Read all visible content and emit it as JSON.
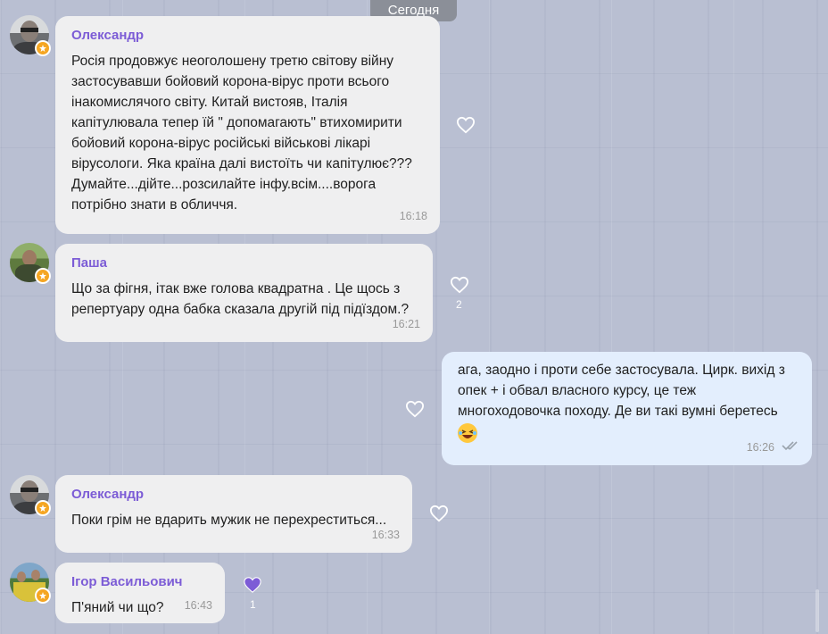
{
  "date_separator": "Сегодня",
  "messages": [
    {
      "sender": "Олександр",
      "text": "Росія продовжує неоголошену третю світову війну\nзастосувавши бойовий корона-вірус проти всього\nінакомислячого світу. Китай вистояв, Італія\nкапітулювала тепер їй  \" допомагають\" втихомирити\nбойовий корона-вірус російські військові лікарі\nвірусологи. Яка країна далі вистоїть чи капітулює???\nДумайте...дійте...розсилайте інфу.всім....ворога\nпотрібно знати в обличчя.",
      "time": "16:18"
    },
    {
      "sender": "Паша",
      "text": "Що за фігня, ітак вже голова квадратна . Це щось з\nрепертуару одна бабка сказала другій під підїздом.?",
      "time": "16:21",
      "likes": "2"
    },
    {
      "sender": "",
      "text": "ага, заодно і проти себе застосувала. Цирк. вихід з\nопек + і обвал власного курсу, це теж\nмногоходовочка походу. Де ви такі вумні беретесь",
      "time": "16:26"
    },
    {
      "sender": "Олександр",
      "text": "Поки грім не вдарить мужик не перехреститься...",
      "time": "16:33"
    },
    {
      "sender": "Ігор Васильович",
      "text": "П'яний чи що?",
      "time": "16:43",
      "likes": "1"
    }
  ],
  "icons": {
    "like": "heart-outline-icon",
    "liked": "heart-filled-icon",
    "badge": "star-badge-icon",
    "read": "double-check-icon",
    "emoji": "laughing-emoji-icon"
  },
  "colors": {
    "sender_name": "#7c5cd6",
    "incoming_bubble": "#efeff0",
    "outgoing_bubble": "#e3eefd",
    "like_filled": "#7c5cd6",
    "badge": "#f5a623"
  }
}
